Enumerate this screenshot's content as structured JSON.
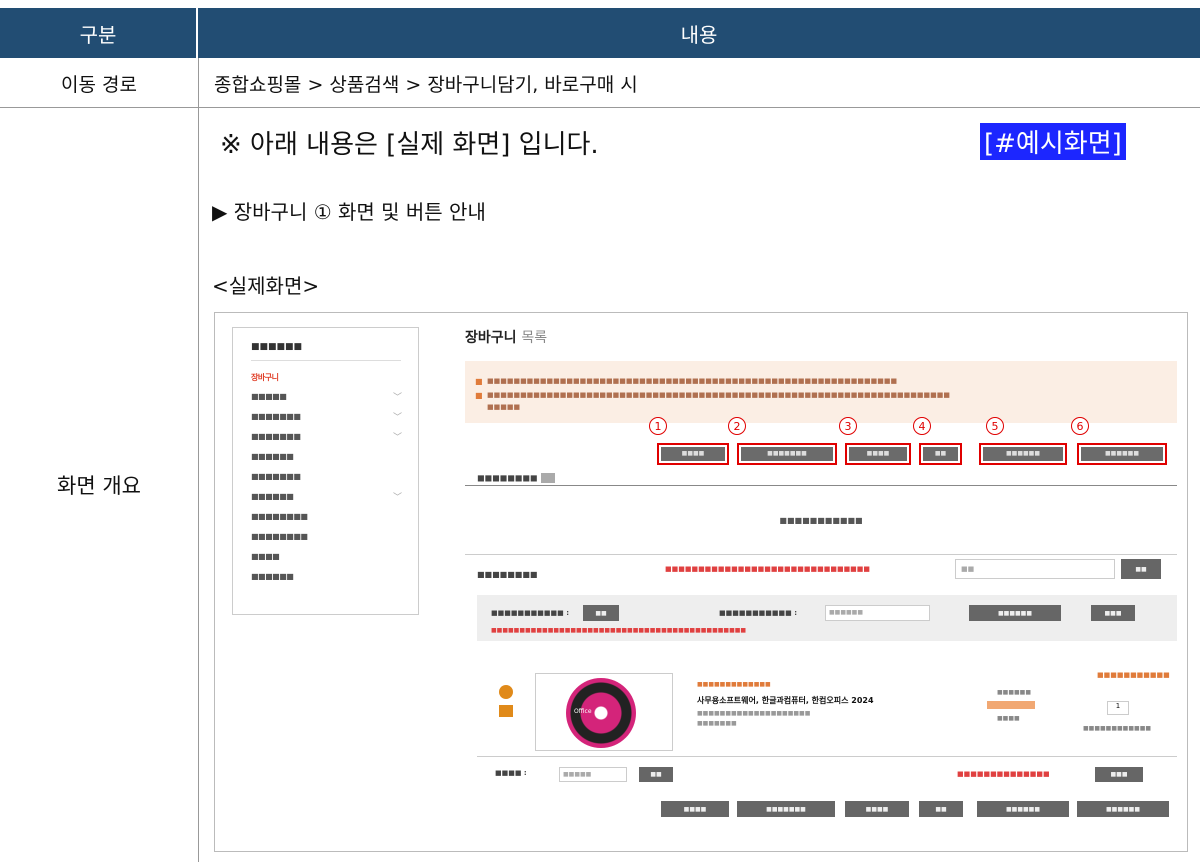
{
  "header": {
    "col1": "구분",
    "col2": "내용"
  },
  "row_path": {
    "label": "이동 경로",
    "value": "종합쇼핑몰 > 상품검색 > 장바구니담기, 바로구매 시"
  },
  "row_overview": {
    "label": "화면 개요",
    "note": "※ 아래 내용은 [실제 화면] 입니다.",
    "tag": "[#예시화면]",
    "subtitle": "▶ 장바구니 ① 화면 및 버튼 안내",
    "screen_label": "<실제화면>"
  },
  "screenshot": {
    "cart_title": "장바구니",
    "cart_title_suffix": "목록",
    "numbers": [
      "1",
      "2",
      "3",
      "4",
      "5",
      "6"
    ],
    "sidebar_items": [
      "장바구니"
    ],
    "product_name": "사무용소프트웨어, 한글과컴퓨터, 한컴오피스 2024",
    "qty": "1",
    "disc_label": "Office"
  }
}
